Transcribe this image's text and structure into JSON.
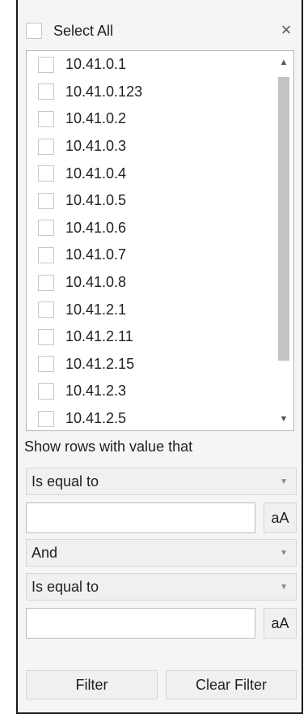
{
  "header": {
    "select_all_label": "Select All",
    "close_icon": "×"
  },
  "values": [
    "10.41.0.1",
    "10.41.0.123",
    "10.41.0.2",
    "10.41.0.3",
    "10.41.0.4",
    "10.41.0.5",
    "10.41.0.6",
    "10.41.0.7",
    "10.41.0.8",
    "10.41.2.1",
    "10.41.2.11",
    "10.41.2.15",
    "10.41.2.3",
    "10.41.2.5"
  ],
  "scrollbar": {
    "up_arrow": "▲",
    "down_arrow": "▼"
  },
  "filter": {
    "caption": "Show rows with value that",
    "operator1": "Is equal to",
    "value1": "",
    "case_label": "aA",
    "logic": "And",
    "operator2": "Is equal to",
    "value2": "",
    "dropdown_caret": "▼",
    "filter_button": "Filter",
    "clear_button": "Clear Filter"
  }
}
